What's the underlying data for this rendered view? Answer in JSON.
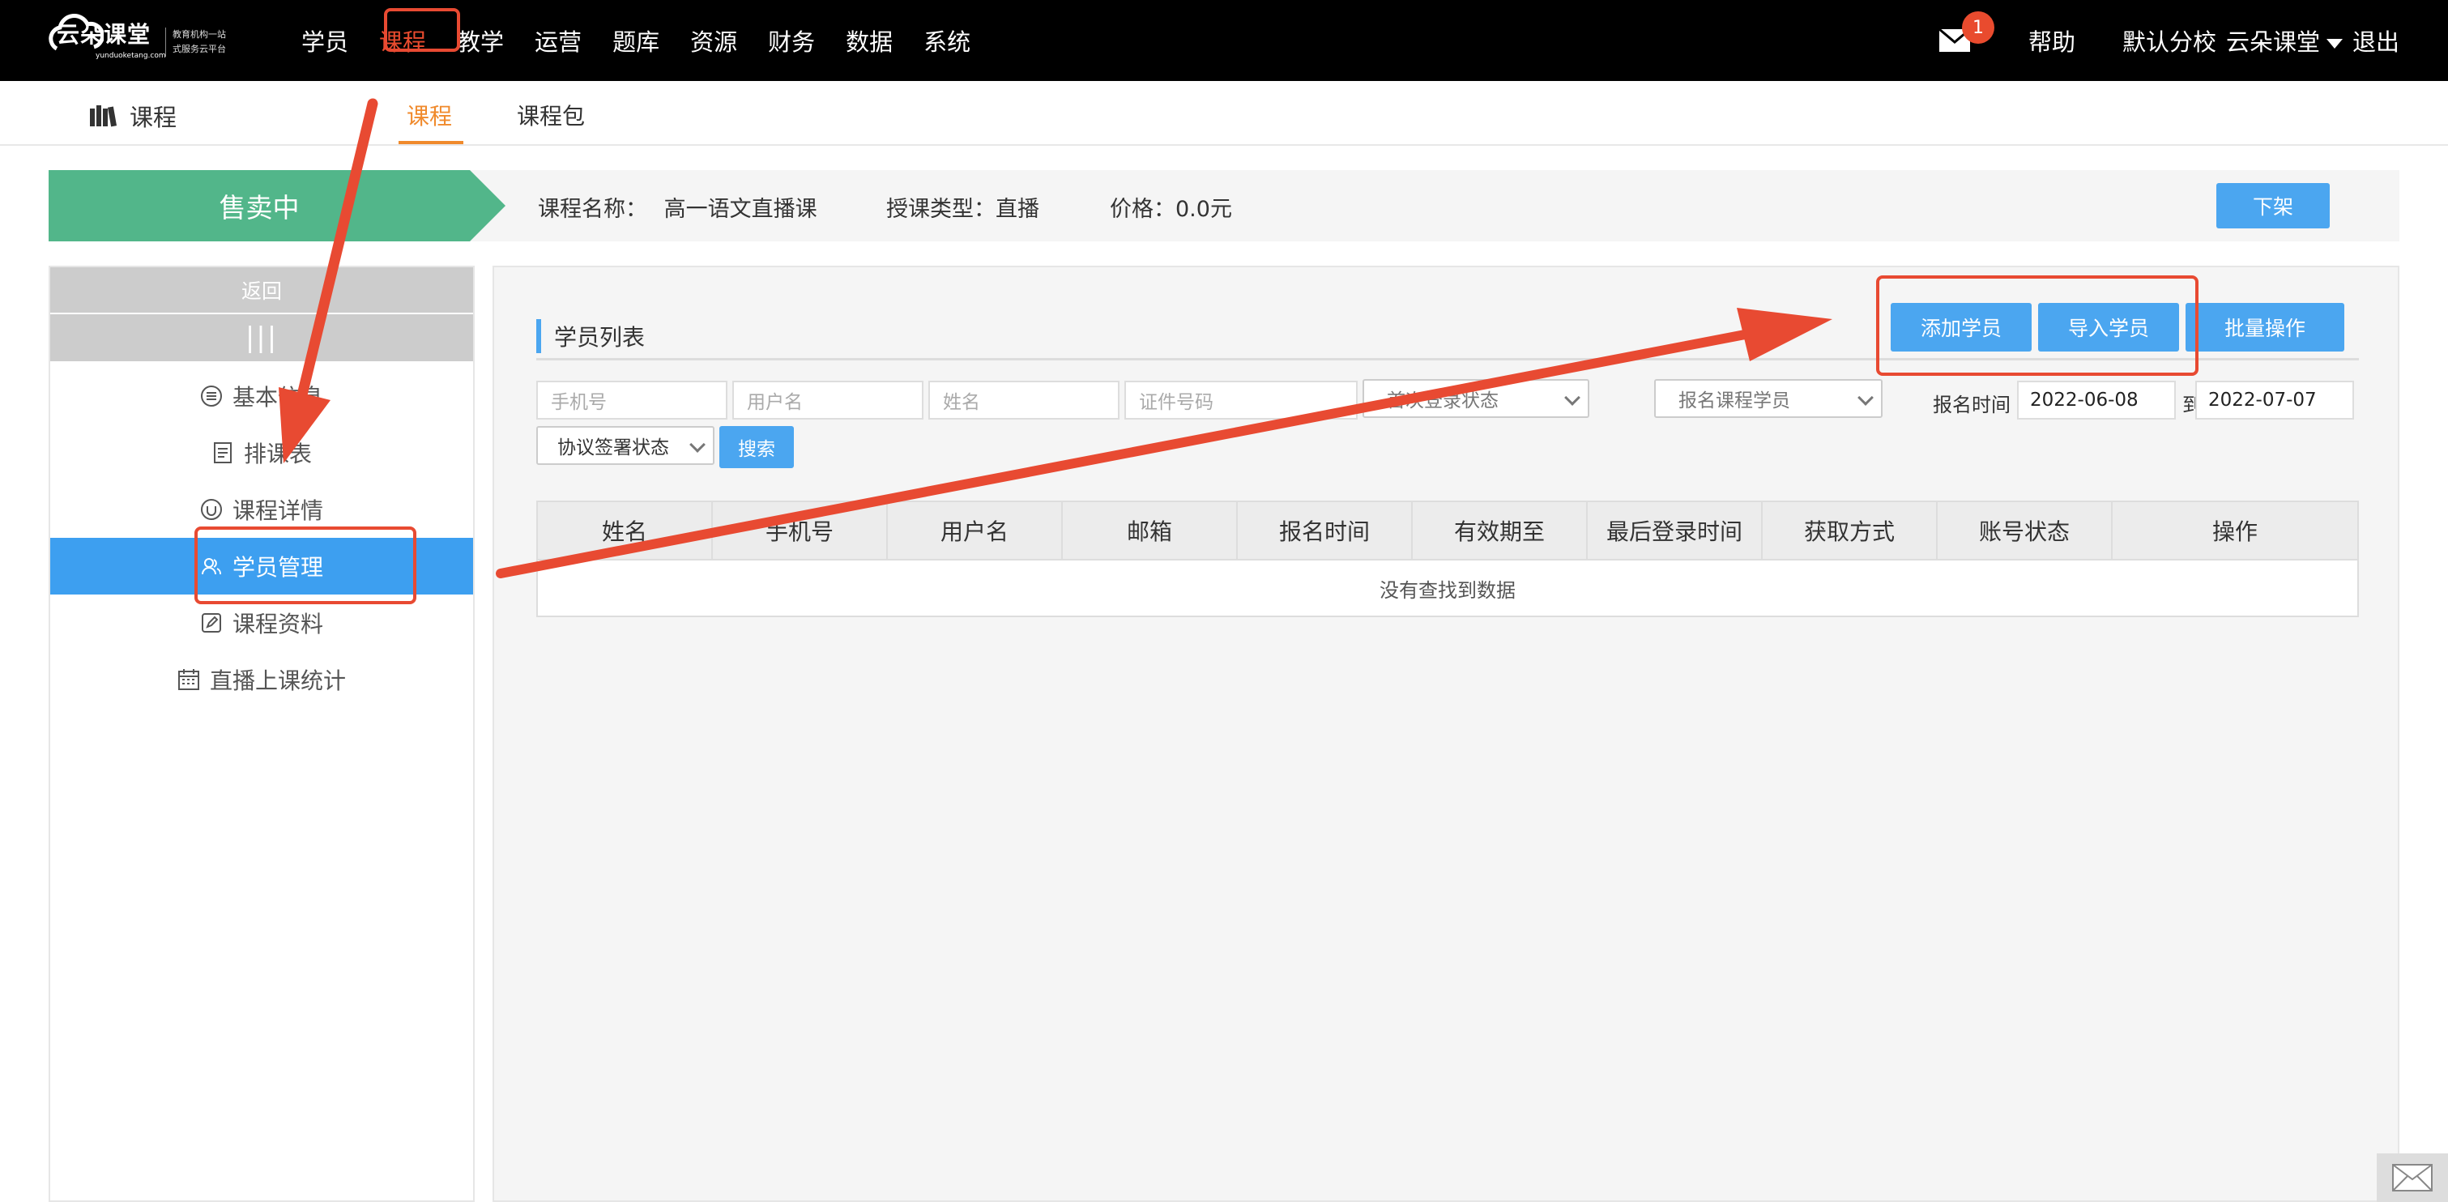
{
  "logo": {
    "title": "云朵课堂",
    "sub": "yunduoketang.com",
    "slogan_1": "教育机构一站",
    "slogan_2": "式服务云平台"
  },
  "nav": {
    "items": [
      "学员",
      "课程",
      "教学",
      "运营",
      "题库",
      "资源",
      "财务",
      "数据",
      "系统"
    ],
    "active": "课程"
  },
  "header_right": {
    "mail_count": "1",
    "help": "帮助",
    "school": "默认分校",
    "user": "云朵课堂",
    "logout": "退出"
  },
  "subnav": {
    "title": "课程",
    "tabs": [
      "课程",
      "课程包"
    ]
  },
  "status": {
    "state": "售卖中",
    "course_name_label": "课程名称：",
    "course_name": "高一语文直播课",
    "type_label": "授课类型：",
    "type": "直播",
    "price_label": "价格：",
    "price": "0.0元",
    "delist_button": "下架"
  },
  "sidebar": {
    "back": "返回",
    "bars": "|||",
    "items": [
      "基本信息",
      "排课表",
      "课程详情",
      "学员管理",
      "课程资料",
      "直播上课统计"
    ],
    "active": "学员管理"
  },
  "main": {
    "list_title": "学员列表",
    "buttons": {
      "add": "添加学员",
      "import": "导入学员",
      "batch": "批量操作"
    },
    "filters": {
      "phone_placeholder": "手机号",
      "username_placeholder": "用户名",
      "name_placeholder": "姓名",
      "id_placeholder": "证件号码",
      "status_select": "首次登录状态",
      "course_select": "报名课程学员",
      "signup_time_label": "报名时间",
      "date_from": "2022-06-08",
      "to_label": "到",
      "date_to": "2022-07-07",
      "agreement_select": "协议签署状态",
      "search_button": "搜索"
    },
    "table": {
      "columns": [
        "姓名",
        "手机号",
        "用户名",
        "邮箱",
        "报名时间",
        "有效期至",
        "最后登录时间",
        "获取方式",
        "账号状态",
        "操作"
      ],
      "empty_text": "没有查找到数据"
    }
  },
  "colors": {
    "accent": "#4ba6f0",
    "sell_green": "#52b68a",
    "annotation_red": "#e84a32",
    "tab_orange": "#f08a2c"
  }
}
